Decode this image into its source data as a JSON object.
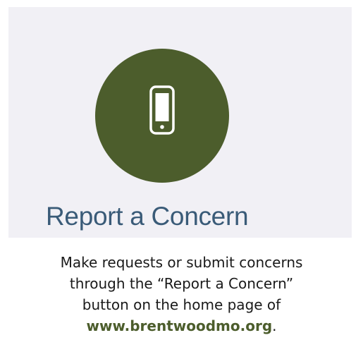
{
  "card": {
    "title": "Report a Concern",
    "icon": "mobile-phone-icon",
    "colors": {
      "card_background": "#f1f0f5",
      "circle": "#4c5d2c",
      "title": "#3a5b78"
    }
  },
  "caption": {
    "line1": "Make requests or submit concerns",
    "line2": "through the “Report a Concern”",
    "line3": "button on the home page of",
    "link_text": "www.brentwoodmo.org",
    "trailing": "."
  }
}
